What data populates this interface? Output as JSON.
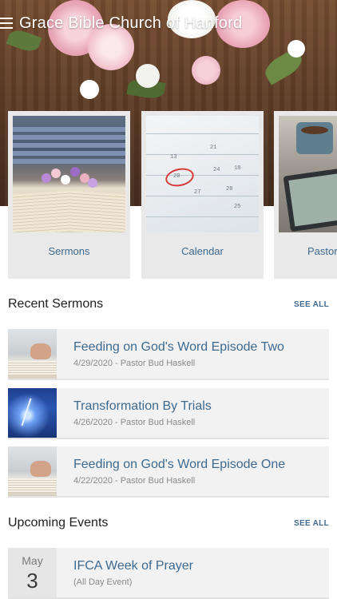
{
  "header": {
    "title": "Grace Bible Church of Hanford",
    "menu_icon": "hamburger-menu-icon"
  },
  "tiles": [
    {
      "label": "Sermons"
    },
    {
      "label": "Calendar"
    },
    {
      "label": "Pastor's"
    }
  ],
  "recent_sermons": {
    "heading": "Recent Sermons",
    "see_all": "SEE ALL",
    "items": [
      {
        "title": "Feeding on God's Word Episode Two",
        "subtitle": "4/29/2020 - Pastor Bud Haskell",
        "thumb": "open-bible"
      },
      {
        "title": "Transformation By Trials",
        "subtitle": "4/26/2020 - Pastor Bud Haskell",
        "thumb": "lightning-storm"
      },
      {
        "title": "Feeding on God's Word Episode One",
        "subtitle": "4/22/2020 - Pastor Bud Haskell",
        "thumb": "open-bible"
      }
    ]
  },
  "upcoming_events": {
    "heading": "Upcoming Events",
    "see_all": "SEE ALL",
    "items": [
      {
        "month": "May",
        "day": "3",
        "title": "IFCA Week of Prayer",
        "subtitle": "(All Day Event)"
      }
    ]
  },
  "colors": {
    "accent": "#3e6a8f",
    "tile_bg": "#e9e9e9",
    "row_bg": "#f2f2f2"
  }
}
